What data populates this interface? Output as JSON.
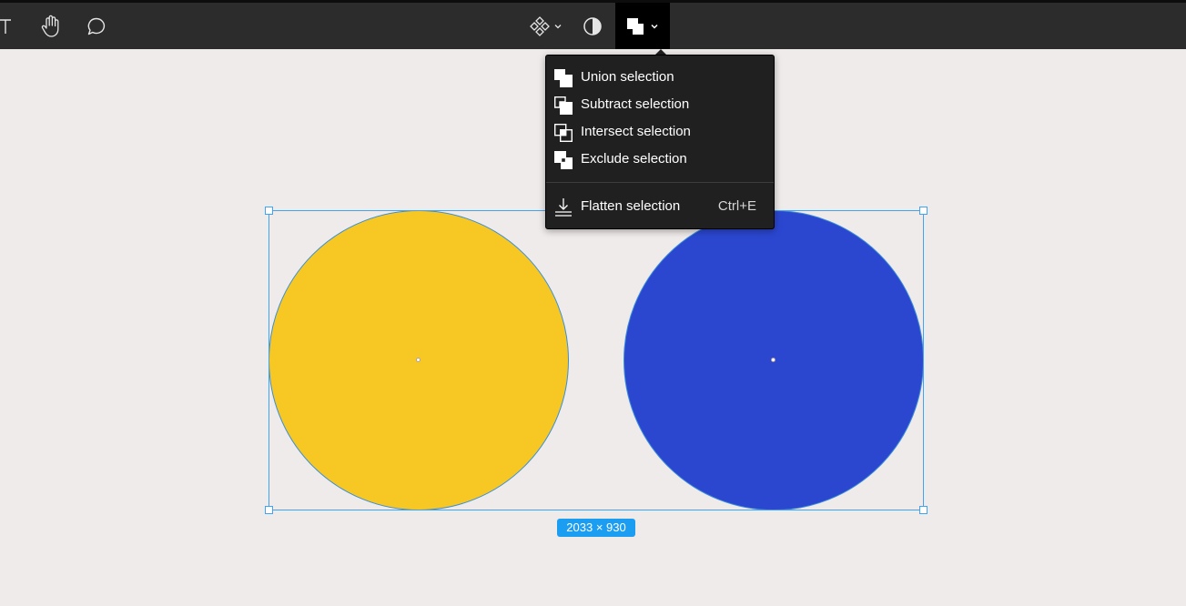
{
  "toolbar": {
    "tools": [
      {
        "name": "text-tool",
        "icon": "text-icon"
      },
      {
        "name": "hand-tool",
        "icon": "hand-icon"
      },
      {
        "name": "comment-tool",
        "icon": "comment-icon"
      },
      {
        "name": "components-tool",
        "icon": "components-icon"
      },
      {
        "name": "mask-tool",
        "icon": "contrast-icon"
      },
      {
        "name": "boolean-tool",
        "icon": "boolean-union-icon"
      }
    ]
  },
  "boolean_menu": {
    "items": [
      {
        "label": "Union selection",
        "icon": "union-icon"
      },
      {
        "label": "Subtract selection",
        "icon": "subtract-icon"
      },
      {
        "label": "Intersect selection",
        "icon": "intersect-icon"
      },
      {
        "label": "Exclude selection",
        "icon": "exclude-icon"
      }
    ],
    "flatten": {
      "label": "Flatten selection",
      "shortcut": "Ctrl+E",
      "icon": "flatten-icon"
    }
  },
  "canvas": {
    "selection_size": "2033 × 930",
    "shapes": [
      {
        "name": "yellow-circle",
        "color": "#f7c823"
      },
      {
        "name": "blue-circle",
        "color": "#2b47d0"
      }
    ],
    "selection_color": "#3fa4f4"
  }
}
